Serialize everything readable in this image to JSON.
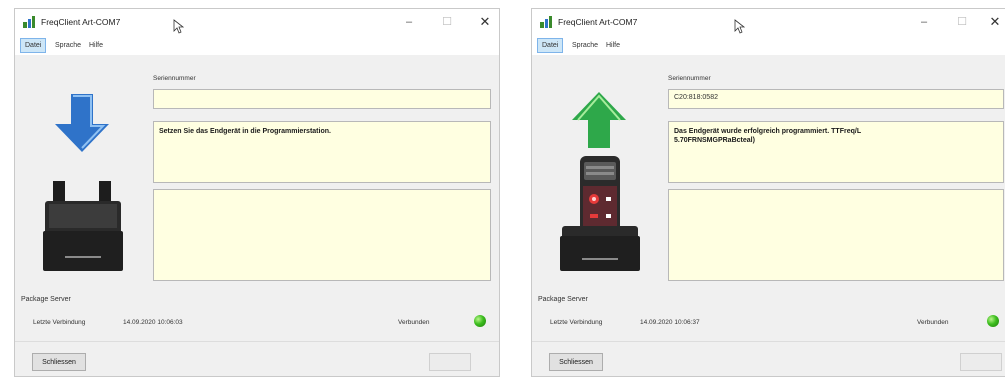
{
  "windows": [
    {
      "title": "FreqClient Art-COM7",
      "minimize_glyph": "–",
      "maximize_glyph": "☐",
      "close_glyph": "✕",
      "menu": [
        "Datei",
        "Sprache",
        "Hilfe"
      ],
      "active_menu": "Datei",
      "device_state": "insert-device",
      "serial_label": "Seriennummer",
      "serial_value": "",
      "message": "Setzen Sie das Endgerät in die Programmierstation.",
      "package_server_label": "Package Server",
      "last_connection_label": "Letzte Verbindung",
      "last_connection_time": "14.09.2020 10:06:03",
      "connection_status": "Verbunden",
      "close_button": "Schliessen",
      "secondary_button": "",
      "status_color": "#3cbd1e"
    },
    {
      "title": "FreqClient Art-COM7",
      "minimize_glyph": "–",
      "maximize_glyph": "☐",
      "close_glyph": "✕",
      "menu": [
        "Datei",
        "Sprache",
        "Hilfe"
      ],
      "active_menu": "Datei",
      "device_state": "programmed",
      "serial_label": "Seriennummer",
      "serial_value": "C20:818:0582",
      "message": "Das Endgerät wurde erfolgreich programmiert. TTFreq/L\n5.70FRNSMGPRaBcteal)",
      "package_server_label": "Package Server",
      "last_connection_label": "Letzte Verbindung",
      "last_connection_time": "14.09.2020 10:06:37",
      "connection_status": "Verbunden",
      "close_button": "Schliessen",
      "secondary_button": "",
      "status_color": "#3cbd1e"
    }
  ],
  "icons": {
    "app": "app-icon",
    "cursor": "mouse-pointer-icon",
    "down_arrow": "arrow-down-icon",
    "up_arrow": "arrow-up-icon"
  },
  "colors": {
    "field_background": "#ffffe1",
    "menu_active": "#cde6f7",
    "arrow_blue": "#2f73c9",
    "arrow_green": "#2ea84a"
  }
}
